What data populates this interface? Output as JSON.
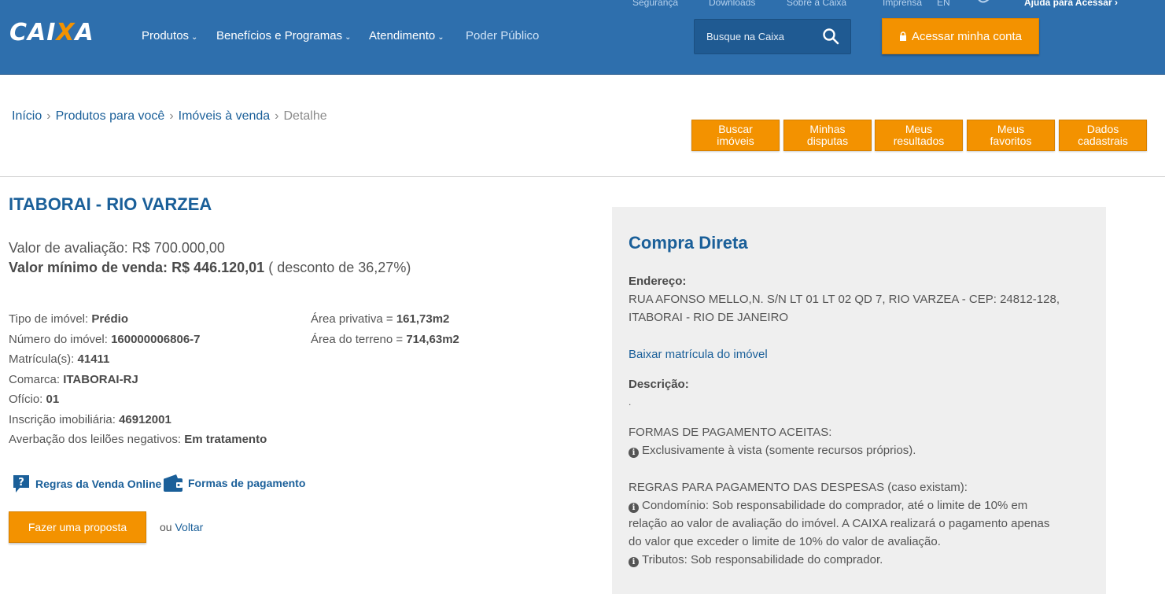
{
  "header": {
    "utility_links": [
      "Segurança",
      "Downloads",
      "Sobre a Caixa",
      "Imprensa",
      "EN",
      "Ajuda para Acessar ›"
    ],
    "logo": {
      "part1": "CAI",
      "part2": "X",
      "part3": "A"
    },
    "nav": [
      {
        "label": "Produtos",
        "dropdown": true
      },
      {
        "label": "Benefícios e Programas",
        "dropdown": true
      },
      {
        "label": "Atendimento",
        "dropdown": true
      },
      {
        "label": "Poder Público",
        "dropdown": false
      }
    ],
    "search": {
      "placeholder": "Busque na Caixa",
      "icon": "search-icon"
    },
    "login_label": "Acessar minha conta",
    "colors": {
      "brand_blue": "#2e6fad",
      "accent_orange": "#f39200"
    }
  },
  "breadcrumb": {
    "items": [
      "Início",
      "Produtos para você",
      "Imóveis à venda"
    ],
    "current": "Detalhe"
  },
  "tabs": [
    {
      "line1": "Buscar",
      "line2": "imóveis"
    },
    {
      "line1": "Minhas",
      "line2": "disputas"
    },
    {
      "line1": "Meus",
      "line2": "resultados"
    },
    {
      "line1": "Meus",
      "line2": "favoritos"
    },
    {
      "line1": "Dados",
      "line2": "cadastrais"
    }
  ],
  "property": {
    "title": "ITABORAI - RIO VARZEA",
    "valor_avaliacao_label": "Valor de avaliação:",
    "valor_avaliacao": "R$ 700.000,00",
    "valor_minimo_label": "Valor mínimo de venda:",
    "valor_minimo": "R$ 446.120,01",
    "desconto": "( desconto de 36,27%)",
    "details_left": [
      {
        "label": "Tipo de imóvel:",
        "value": "Prédio"
      },
      {
        "label": "Número do imóvel:",
        "value": "160000006806-7"
      },
      {
        "label": "Matrícula(s):",
        "value": "41411"
      },
      {
        "label": "Comarca:",
        "value": "ITABORAI-RJ"
      },
      {
        "label": "Ofício:",
        "value": "01"
      },
      {
        "label": "Inscrição imobiliária:",
        "value": "46912001"
      },
      {
        "label": "Averbação dos leilões negativos:",
        "value": "Em tratamento"
      }
    ],
    "details_right": [
      {
        "label": "Área privativa =",
        "value": "161,73m2"
      },
      {
        "label": "Área do terreno =",
        "value": "714,63m2"
      }
    ],
    "link_regras": "Regras da Venda Online",
    "link_formas": "Formas de pagamento",
    "proposta_label": "Fazer uma proposta",
    "ou": "ou",
    "voltar": "Voltar"
  },
  "panel": {
    "title": "Compra Direta",
    "endereco_label": "Endereço:",
    "endereco_line1": "RUA AFONSO MELLO,N. S/N LT 01 LT 02 QD 7, RIO VARZEA - CEP: 24812-128,",
    "endereco_line2": "ITABORAI - RIO DE JANEIRO",
    "matricula_link": "Baixar matrícula do imóvel",
    "descricao_label": "Descrição:",
    "descricao_text": ".",
    "formas_title": "FORMAS DE PAGAMENTO ACEITAS:",
    "formas_item": "Exclusivamente à vista (somente recursos próprios).",
    "regras_title": "REGRAS PARA PAGAMENTO DAS DESPESAS (caso existam):",
    "regras_condominio_1": "Condomínio: Sob responsabilidade do comprador, até o limite de 10% em",
    "regras_condominio_2": "relação ao valor de avaliação do imóvel. A CAIXA realizará o pagamento apenas",
    "regras_condominio_3": "do valor que exceder o limite de 10% do valor de avaliação.",
    "regras_tributos": "Tributos: Sob responsabilidade do comprador."
  }
}
